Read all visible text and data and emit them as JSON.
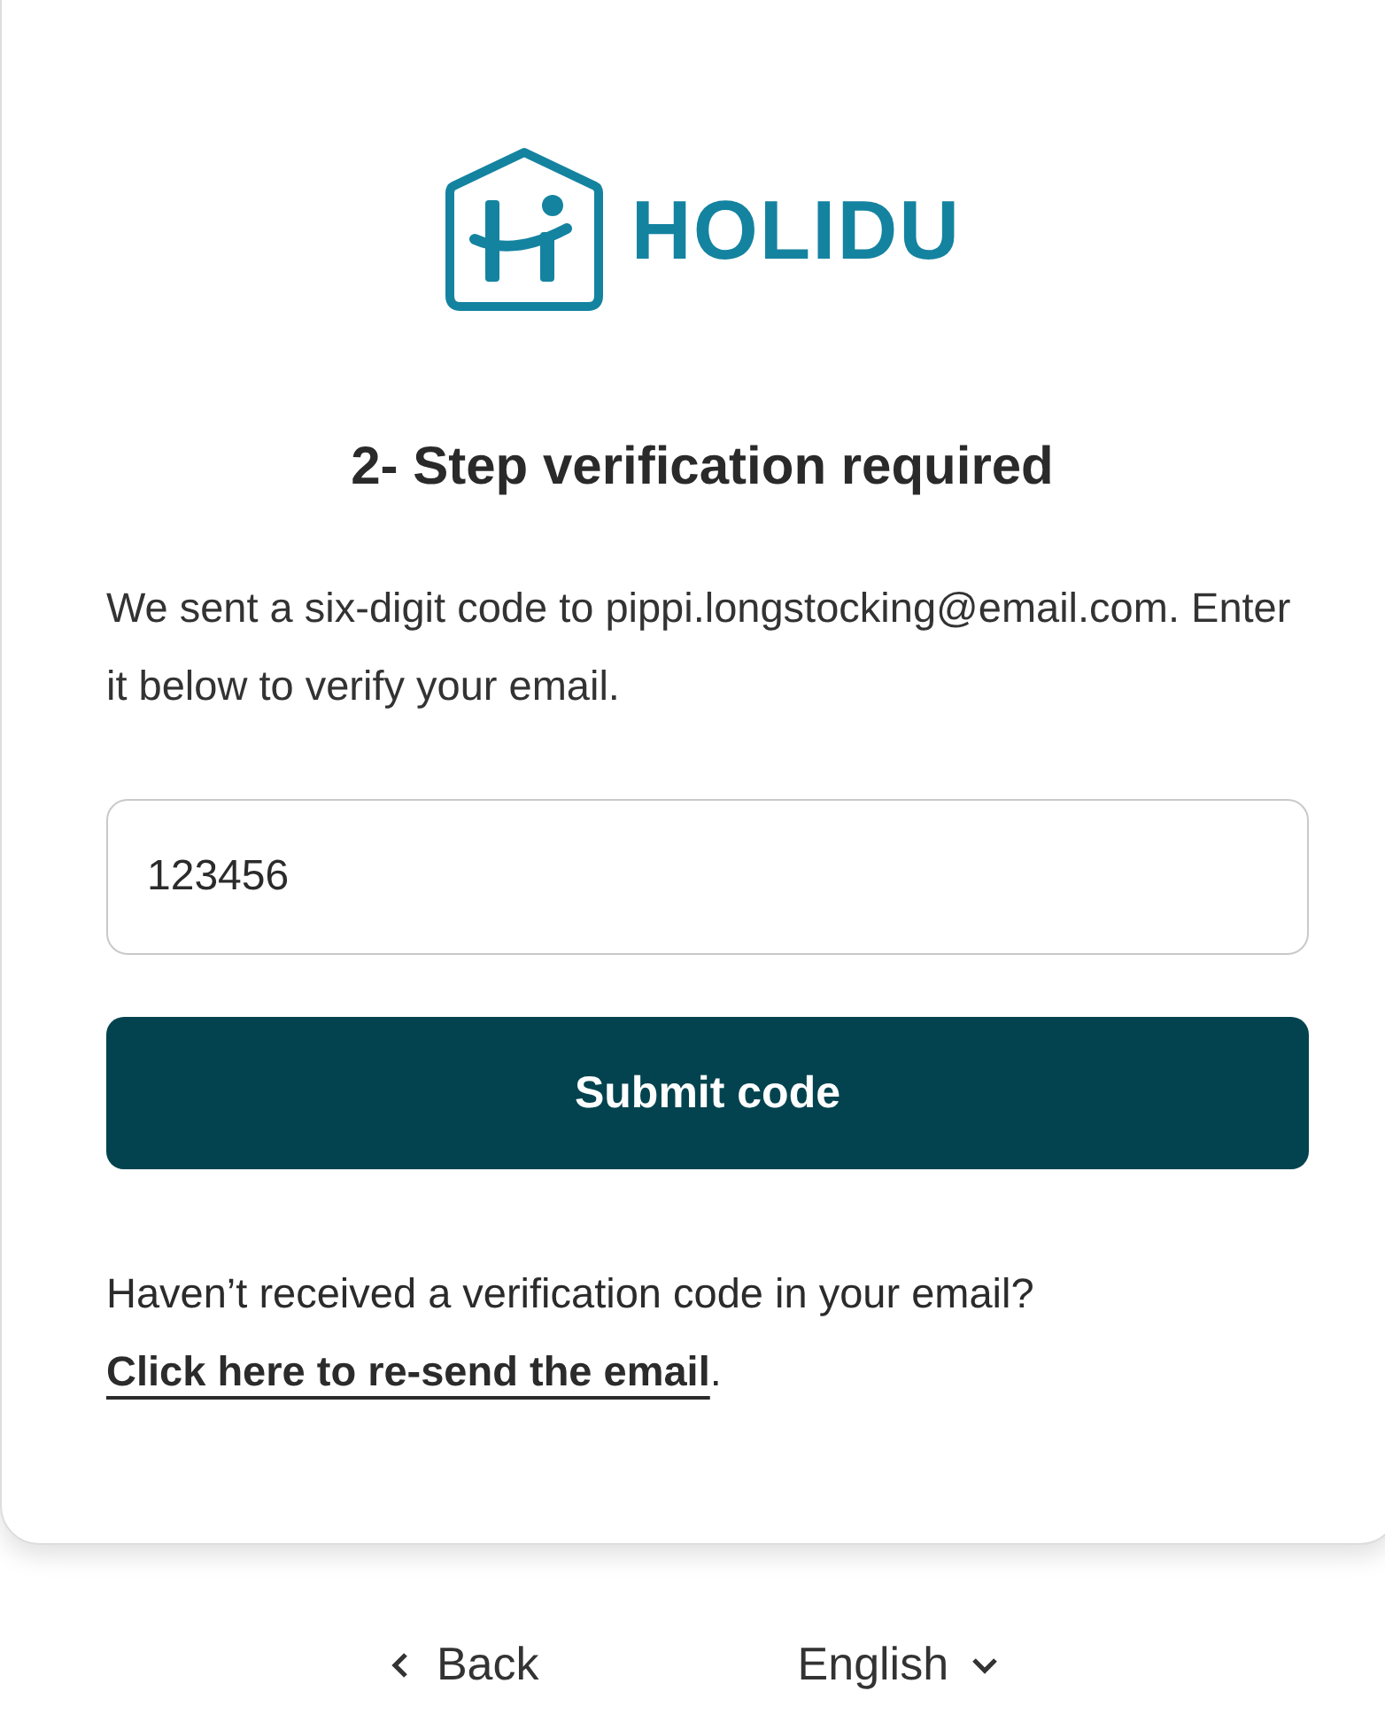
{
  "logo": {
    "text": "HOLIDU"
  },
  "title": "2- Step verification required",
  "description": "We sent a six-digit code to pippi.longstocking@email.com. Enter it below to verify your email.",
  "code_field": {
    "value": "123456"
  },
  "submit_button": "Submit code",
  "resend": {
    "text": "Haven’t received a verification code in your email?",
    "link": "Click here to re-send the email",
    "suffix": "."
  },
  "footer": {
    "back": "Back",
    "language": "English"
  }
}
